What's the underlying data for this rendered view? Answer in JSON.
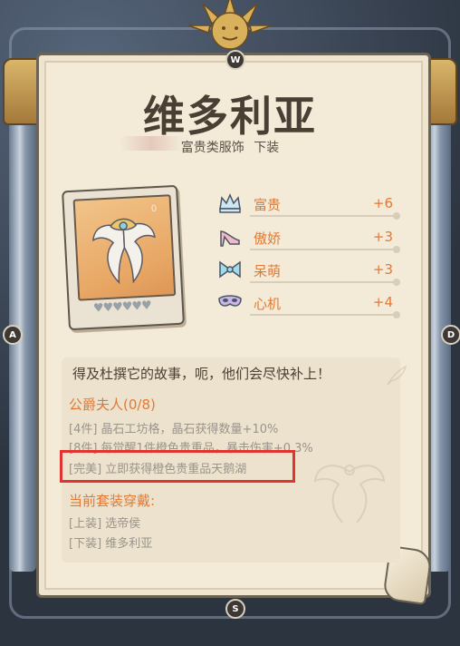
{
  "item": {
    "name": "维多利亚",
    "category": "富贵类服饰",
    "slot": "下装",
    "card_count": "0",
    "hearts": "♥♥♥♥♥♥"
  },
  "attributes": [
    {
      "icon": "crown-icon",
      "label": "富贵",
      "value": "+6"
    },
    {
      "icon": "high-heel-icon",
      "label": "傲娇",
      "value": "+3"
    },
    {
      "icon": "bow-icon",
      "label": "呆萌",
      "value": "+3"
    },
    {
      "icon": "mask-icon",
      "label": "心机",
      "value": "+4"
    }
  ],
  "description": "得及杜撰它的故事，呃，他们会尽快补上！",
  "set": {
    "name": "公爵夫人(0/8)",
    "bonuses": [
      "[4件] 晶石工坊格，晶石获得数量+10%",
      "[8件] 每觉醒1件橙色贵重品，暴击伤害+0.3%",
      "[完美] 立即获得橙色贵重品天鹅湖"
    ]
  },
  "wearing": {
    "title": "当前套装穿戴:",
    "items": [
      "[上装] 选帝侯",
      "[下装] 维多利亚"
    ]
  },
  "compass": {
    "n": "W",
    "w": "A",
    "e": "D",
    "s": "S"
  },
  "colors": {
    "accent": "#e07a35",
    "highlight": "#e0352f",
    "parchment": "#f3ead7"
  }
}
